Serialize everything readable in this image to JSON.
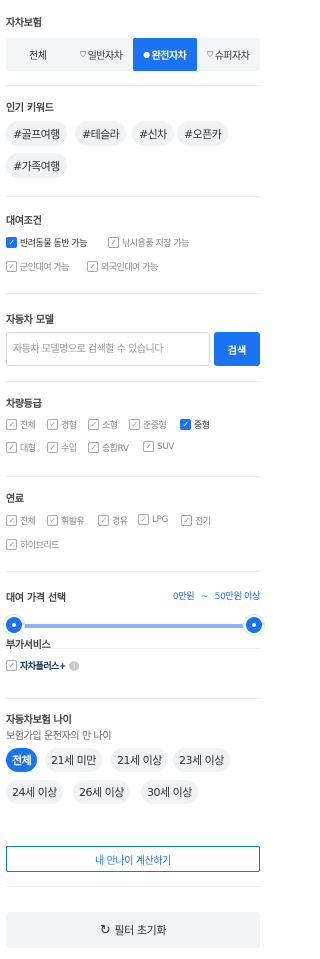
{
  "insurance": {
    "title": "자차보험",
    "options": [
      {
        "label": "전체",
        "icon": "",
        "active": false
      },
      {
        "label": "일반자차",
        "icon": "shield-icon",
        "active": false
      },
      {
        "label": "완전자차",
        "icon": "shield-icon",
        "active": true
      },
      {
        "label": "슈퍼자차",
        "icon": "shield-icon",
        "active": false
      }
    ]
  },
  "keywords": {
    "title": "인기 키워드",
    "items": [
      "#골프여행",
      "#테슬라",
      "#신차",
      "#오픈카",
      "#가족여행"
    ]
  },
  "rental_conditions": {
    "title": "대여조건",
    "items": [
      {
        "label": "반려동물 동반 가능",
        "checked": true
      },
      {
        "label": "낚시용품 지참 가능",
        "checked": false
      },
      {
        "label": "군인대여 가능",
        "checked": false
      },
      {
        "label": "외국인대여 가능",
        "checked": false
      }
    ]
  },
  "model_search": {
    "title": "자동차 모델",
    "placeholder": "자동차 모델명으로 검색할 수 있습니다",
    "value": "",
    "button": "검색"
  },
  "car_class": {
    "title": "차량등급",
    "items": [
      {
        "label": "전체",
        "checked": false
      },
      {
        "label": "경형",
        "checked": false
      },
      {
        "label": "소형",
        "checked": false
      },
      {
        "label": "준중형",
        "checked": false
      },
      {
        "label": "중형",
        "checked": true
      },
      {
        "label": "대형",
        "checked": false
      },
      {
        "label": "수입",
        "checked": false
      },
      {
        "label": "승합RV",
        "checked": false
      },
      {
        "label": "SUV",
        "checked": false
      }
    ]
  },
  "fuel": {
    "title": "연료",
    "items": [
      {
        "label": "전체",
        "checked": false
      },
      {
        "label": "휘발유",
        "checked": false
      },
      {
        "label": "경유",
        "checked": false
      },
      {
        "label": "LPG",
        "checked": false
      },
      {
        "label": "전기",
        "checked": false
      },
      {
        "label": "하이브리드",
        "checked": false
      }
    ]
  },
  "price": {
    "title": "대여 가격 선택",
    "min_label": "0만원",
    "separator": "~",
    "max_label": "50만원 이상",
    "min_value": 0,
    "max_value": 50
  },
  "extra": {
    "title": "부가서비스",
    "item_label": "자차플러스+",
    "checked": false,
    "info_icon": "info-icon"
  },
  "age": {
    "title": "자동차보험 나이",
    "subtitle": "보험가입 운전자의 만 나이",
    "options": [
      "전체",
      "21세 미만",
      "21세 이상",
      "23세 이상",
      "24세 이상",
      "26세 이상",
      "30세 이상"
    ],
    "active_index": 0,
    "calc_button": "내 만나이 계산하기"
  },
  "reset": {
    "label": "필터 초기화",
    "icon": "refresh-icon"
  },
  "colors": {
    "accent": "#1a73f2",
    "chip_bg": "#f1f2f4",
    "text": "#333333"
  }
}
